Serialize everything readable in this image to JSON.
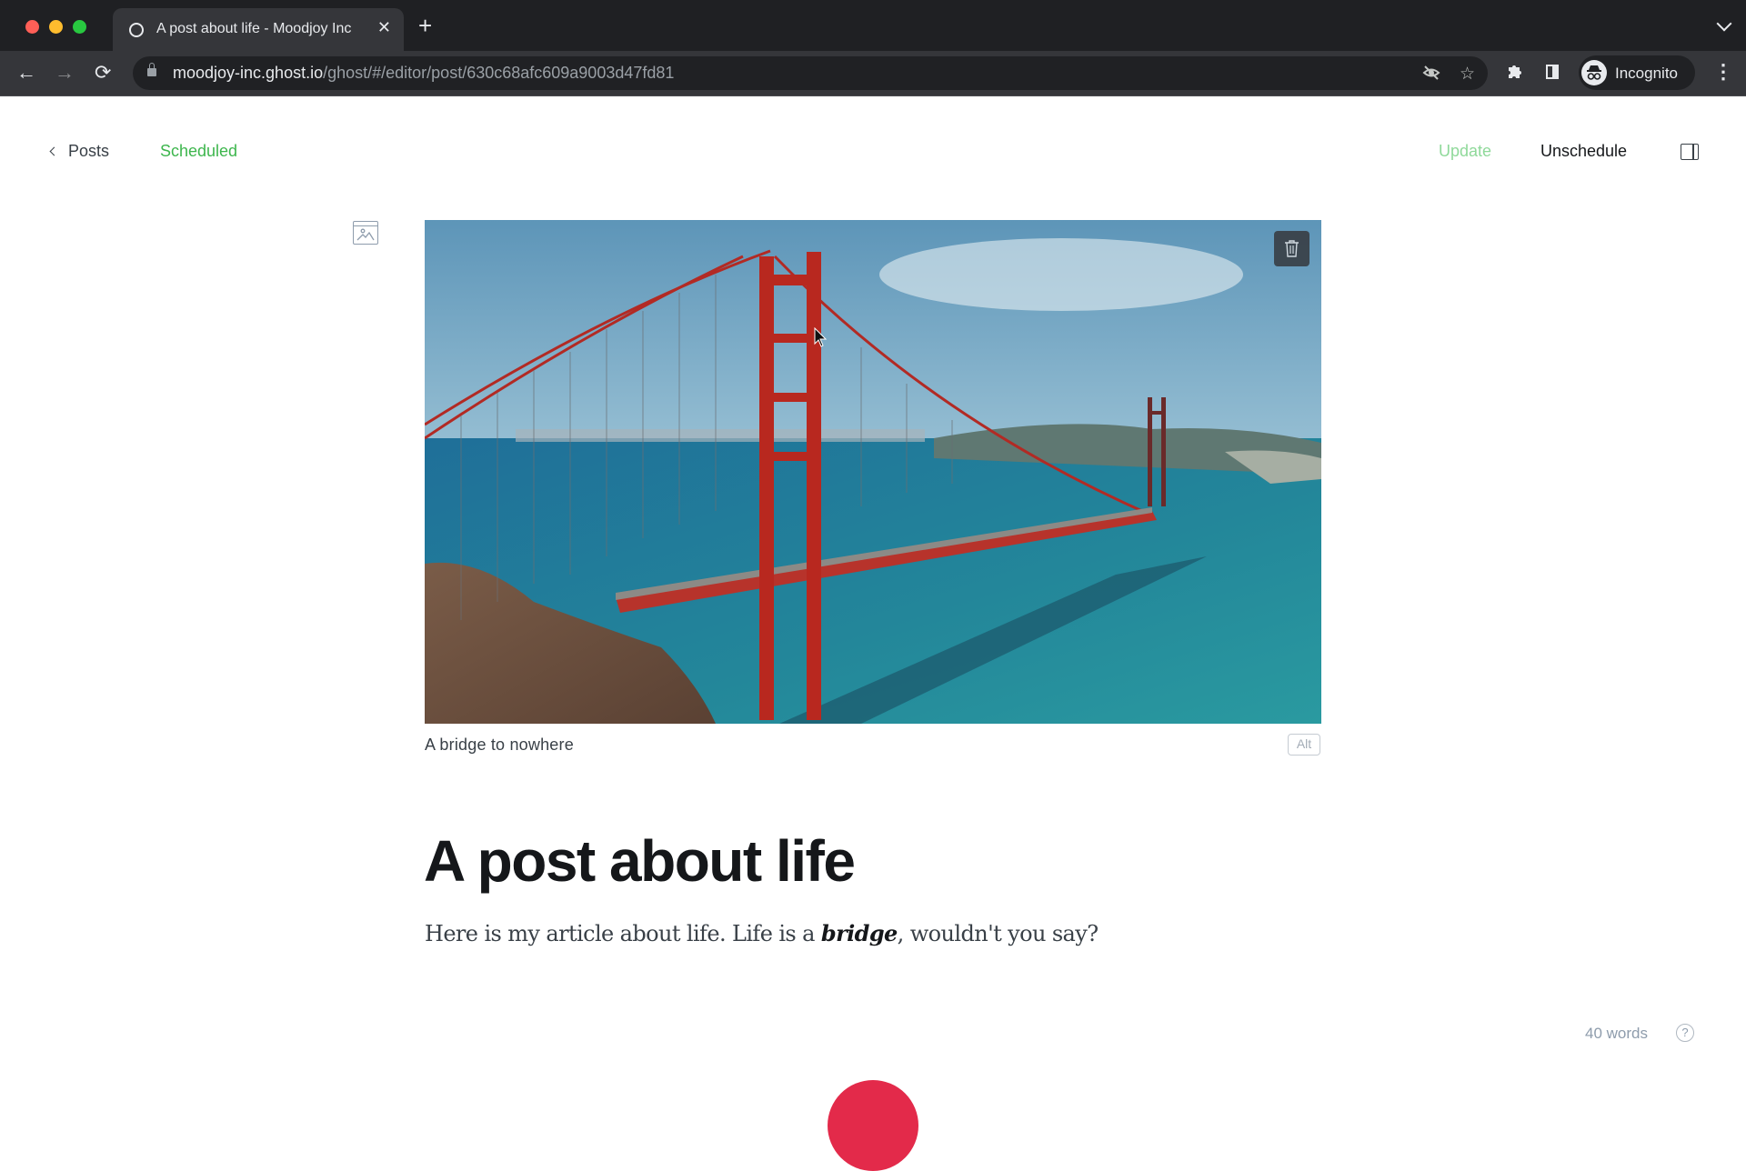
{
  "browser": {
    "tab_title": "A post about life - Moodjoy Inc",
    "url_host": "moodjoy-inc.ghost.io",
    "url_path": "/ghost/#/editor/post/630c68afc609a9003d47fd81",
    "profile_label": "Incognito",
    "icons": {
      "back": "←",
      "forward": "→",
      "reload": "⟳",
      "new_tab": "+",
      "close_tab": "✕",
      "eye_off": "◎",
      "star": "☆",
      "extensions": "✱",
      "incognito": "👓",
      "menu": "⋮"
    }
  },
  "editor": {
    "back_label": "Posts",
    "status": "Scheduled",
    "update_label": "Update",
    "unschedule_label": "Unschedule",
    "feature_image": {
      "caption": "A bridge to nowhere",
      "alt_label": "Alt",
      "description": "Golden Gate Bridge over turquoise water"
    },
    "title": "A post about life",
    "body": {
      "before": "Here is my article about life. Life is a ",
      "emphasis": "bridge",
      "after": ", wouldn't you say?"
    },
    "word_count": "40 words",
    "help_label": "?"
  },
  "colors": {
    "status_green": "#3db64d",
    "update_green": "#8fd99a",
    "bridge_red": "#c02a26",
    "bottom_accent": "#e32a4a"
  }
}
